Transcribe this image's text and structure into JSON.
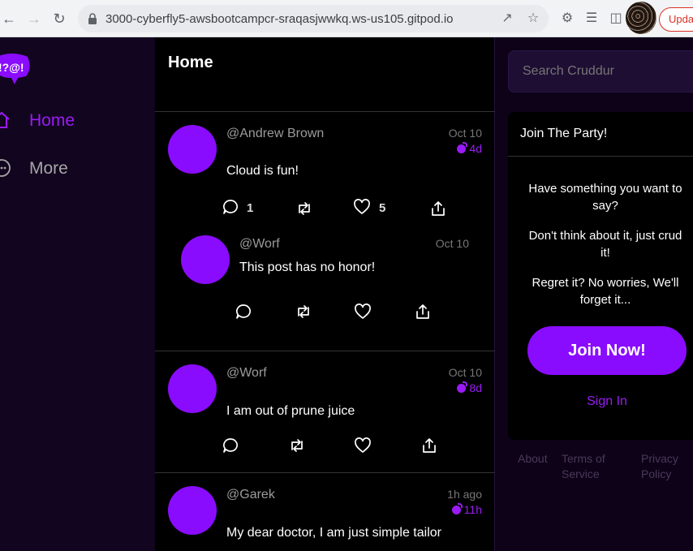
{
  "browser": {
    "url": "3000-cyberfly5-awsbootcampcr-sraqasjwwkq.ws-us105.gitpod.io",
    "update_label": "Upda"
  },
  "brand": {
    "logo_text": "!?@!",
    "accent_color": "#8a0cff"
  },
  "sidebar": {
    "items": [
      {
        "label": "Home",
        "icon": "home-icon",
        "active": true,
        "color": "#9a1bf5"
      },
      {
        "label": "More",
        "icon": "more-icon",
        "active": false,
        "color": "#a6a6a6"
      }
    ]
  },
  "feed": {
    "title": "Home",
    "activities": [
      {
        "handle": "@Andrew Brown",
        "time": "Oct 10",
        "expires": "4d",
        "message": "Cloud is fun!",
        "replies": "1",
        "likes": "5",
        "reply": {
          "handle": "@Worf",
          "time": "Oct 10",
          "message": "This post has no honor!"
        }
      },
      {
        "handle": "@Worf",
        "time": "Oct 10",
        "expires": "8d",
        "message": "I am out of prune juice"
      },
      {
        "handle": "@Garek",
        "time": "1h ago",
        "expires": "11h",
        "message": "My dear doctor, I am just simple tailor"
      }
    ]
  },
  "right": {
    "search_placeholder": "Search Cruddur",
    "join": {
      "title": "Join The Party!",
      "para1": "Have something you want to say?",
      "para2": "Don't think about it, just crud it!",
      "para3": "Regret it? No worries, We'll forget it...",
      "button": "Join Now!",
      "signin": "Sign In"
    },
    "footer": {
      "about": "About",
      "terms": "Terms of Service",
      "privacy": "Privacy Policy"
    }
  }
}
